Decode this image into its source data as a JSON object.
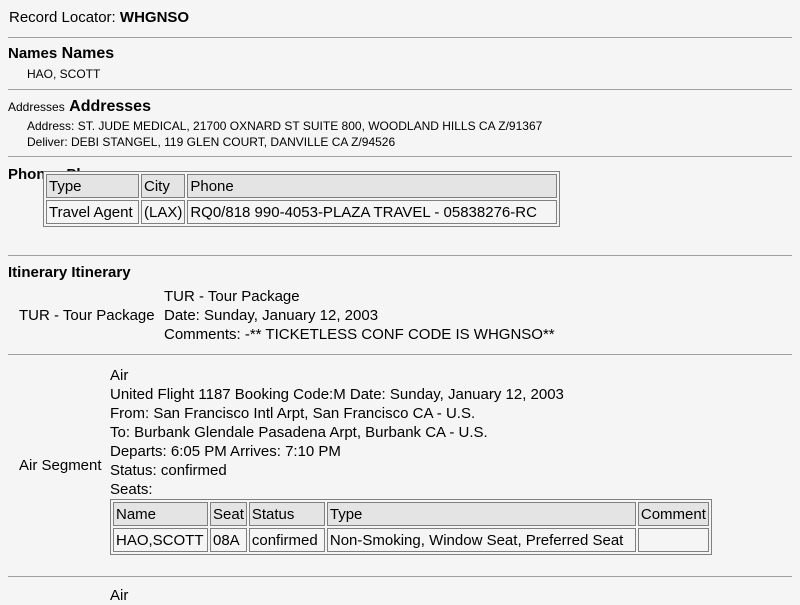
{
  "record": {
    "label": "Record Locator:",
    "value": "WHGNSO"
  },
  "names": {
    "heading_small": "Names",
    "heading_big": "Names",
    "entries": [
      "HAO, SCOTT"
    ]
  },
  "addresses": {
    "heading_small": "Addresses",
    "heading_big": "Addresses",
    "lines": [
      "Address: ST. JUDE MEDICAL, 21700 OXNARD ST SUITE 800, WOODLAND HILLS CA Z/91367",
      "Deliver: DEBI STANGEL, 119 GLEN COURT, DANVILLE CA Z/94526"
    ]
  },
  "phones": {
    "heading_small": "Phones",
    "heading_big": "Phones",
    "columns": [
      "Type",
      "City",
      "Phone"
    ],
    "rows": [
      [
        "Travel Agent",
        "(LAX)",
        "RQ0/818 990-4053-PLAZA TRAVEL - 05838276-RC"
      ]
    ]
  },
  "itinerary": {
    "heading_small": "Itinerary",
    "heading_big": "Itinerary",
    "tour": {
      "label": "TUR - Tour Package",
      "lines": [
        "TUR - Tour Package",
        "Date: Sunday, January 12, 2003",
        "Comments: -** TICKETLESS CONF CODE IS WHGNSO**"
      ]
    },
    "air": {
      "label": "Air Segment",
      "lines": [
        "Air",
        "United Flight 1187 Booking Code:M Date: Sunday, January 12, 2003",
        "From: San Francisco Intl Arpt, San Francisco CA - U.S.",
        "To: Burbank Glendale Pasadena Arpt, Burbank CA - U.S.",
        "Departs: 6:05 PM Arrives: 7:10 PM",
        "Status: confirmed",
        "Seats:"
      ],
      "seat_columns": [
        "Name",
        "Seat",
        "Status",
        "Type",
        "Comment"
      ],
      "seat_rows": [
        [
          "HAO,SCOTT",
          "08A",
          "confirmed",
          "Non-Smoking, Window Seat, Preferred Seat",
          ""
        ]
      ]
    },
    "next": {
      "line": "Air"
    }
  }
}
